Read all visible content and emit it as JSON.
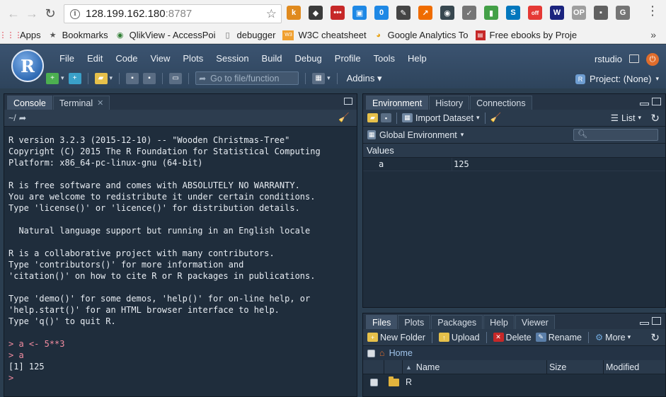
{
  "browser": {
    "url_host": "128.199.162.180",
    "url_port": ":8787",
    "extensions": [
      {
        "name": "k-icon",
        "label": "k",
        "color": "#e08a1e"
      },
      {
        "name": "evernote-icon",
        "label": "◆",
        "color": "#3b3b3b"
      },
      {
        "name": "ext-red-icon",
        "label": "•••",
        "color": "#c62828"
      },
      {
        "name": "ext-blue-icon",
        "label": "▣",
        "color": "#1e88e5"
      },
      {
        "name": "ext-badge-icon",
        "label": "0",
        "color": "#1e88e5"
      },
      {
        "name": "dropper-icon",
        "label": "✎",
        "color": "#444444"
      },
      {
        "name": "ext-orange-icon",
        "label": "↗",
        "color": "#ef6c00"
      },
      {
        "name": "ext-dark-icon",
        "label": "◉",
        "color": "#37474f"
      },
      {
        "name": "ext-check-icon",
        "label": "✓",
        "color": "#757575"
      },
      {
        "name": "ext-green-chart-icon",
        "label": "▮",
        "color": "#43a047"
      },
      {
        "name": "ext-s-icon",
        "label": "S",
        "color": "#0277bd"
      },
      {
        "name": "ext-off-icon",
        "label": "off",
        "color": "#e53935"
      },
      {
        "name": "ext-w-icon",
        "label": "W",
        "color": "#1a237e"
      },
      {
        "name": "ext-op-icon",
        "label": "OP",
        "color": "#9e9e9e"
      },
      {
        "name": "ext-gray-icon",
        "label": "▪",
        "color": "#616161"
      },
      {
        "name": "ext-g-icon",
        "label": "G",
        "color": "#757575"
      }
    ]
  },
  "bookmarks": {
    "apps": "Apps",
    "items": [
      {
        "label": "Bookmarks",
        "icon": "star-icon"
      },
      {
        "label": "QlikView - AccessPoi",
        "icon": "qlik-icon"
      },
      {
        "label": "debugger",
        "icon": "page-icon"
      },
      {
        "label": "W3C cheatsheet",
        "icon": "w3c-icon"
      },
      {
        "label": "Google Analytics To",
        "icon": "chrome-icon"
      },
      {
        "label": "Free ebooks by Proje",
        "icon": "gutenberg-icon"
      }
    ],
    "more": "»"
  },
  "rstudio": {
    "logo": "R",
    "menu": [
      "File",
      "Edit",
      "Code",
      "View",
      "Plots",
      "Session",
      "Build",
      "Debug",
      "Profile",
      "Tools",
      "Help"
    ],
    "user": "rstudio",
    "goto_placeholder": "Go to file/function",
    "addins": "Addins",
    "project": "Project: (None)"
  },
  "console_pane": {
    "tabs": [
      "Console",
      "Terminal"
    ],
    "path": "~/",
    "lines": [
      "R version 3.2.3 (2015-12-10) -- \"Wooden Christmas-Tree\"",
      "Copyright (C) 2015 The R Foundation for Statistical Computing",
      "Platform: x86_64-pc-linux-gnu (64-bit)",
      "",
      "R is free software and comes with ABSOLUTELY NO WARRANTY.",
      "You are welcome to redistribute it under certain conditions.",
      "Type 'license()' or 'licence()' for distribution details.",
      "",
      "  Natural language support but running in an English locale",
      "",
      "R is a collaborative project with many contributors.",
      "Type 'contributors()' for more information and",
      "'citation()' on how to cite R or R packages in publications.",
      "",
      "Type 'demo()' for some demos, 'help()' for on-line help, or",
      "'help.start()' for an HTML browser interface to help.",
      "Type 'q()' to quit R.",
      ""
    ],
    "commands": [
      "> a <- 5**3",
      "> a"
    ],
    "output": "[1] 125",
    "prompt": "> "
  },
  "env_pane": {
    "tabs": [
      "Environment",
      "History",
      "Connections"
    ],
    "import_dataset": "Import Dataset",
    "list_label": "List",
    "global_env": "Global Environment",
    "section": "Values",
    "rows": [
      {
        "name": "a",
        "value": "125"
      }
    ]
  },
  "files_pane": {
    "tabs": [
      "Files",
      "Plots",
      "Packages",
      "Help",
      "Viewer"
    ],
    "actions": [
      "New Folder",
      "Upload",
      "Delete",
      "Rename",
      "More"
    ],
    "breadcrumb": "Home",
    "columns": [
      "Name",
      "Size",
      "Modified"
    ],
    "rows": [
      {
        "name": "R",
        "size": "",
        "modified": ""
      }
    ]
  }
}
